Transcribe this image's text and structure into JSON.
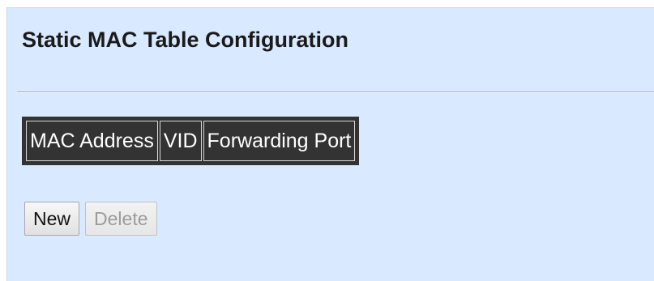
{
  "page": {
    "title": "Static MAC Table Configuration"
  },
  "table": {
    "headers": {
      "mac_address": "MAC Address",
      "vid": "VID",
      "forwarding_port": "Forwarding Port"
    }
  },
  "buttons": {
    "new_label": "New",
    "delete_label": "Delete",
    "delete_disabled": true
  },
  "colors": {
    "panel_background": "#d9e9ff",
    "table_header_background": "#333333",
    "table_header_text": "#ffffff"
  }
}
